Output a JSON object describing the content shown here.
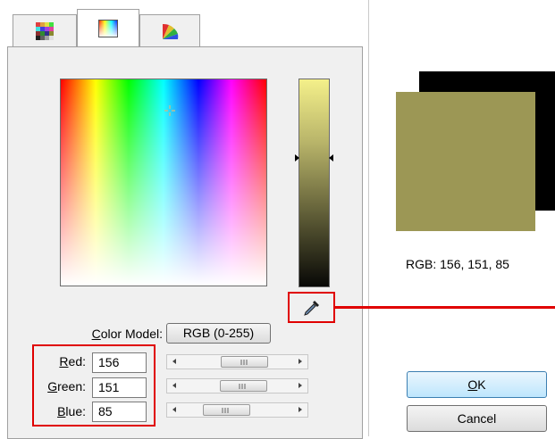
{
  "tabs": [
    {
      "icon": "swatch-grid-icon"
    },
    {
      "icon": "color-gradient-icon",
      "selected": true
    },
    {
      "icon": "color-wheel-icon"
    }
  ],
  "picker": {
    "eyedropper_icon": "eyedropper-icon"
  },
  "color_model": {
    "label_prefix": "",
    "label_mnemonic": "C",
    "label_rest": "olor Model:",
    "value": "RGB (0-255)"
  },
  "channels": [
    {
      "mnemonic": "R",
      "label_rest": "ed:",
      "value": "156",
      "fraction": 0.612
    },
    {
      "mnemonic": "G",
      "label_rest": "reen:",
      "value": "151",
      "fraction": 0.592
    },
    {
      "mnemonic": "B",
      "label_rest": "lue:",
      "value": "85",
      "fraction": 0.333
    }
  ],
  "preview": {
    "old_color": "#000000",
    "new_color": "#9c9755",
    "readout": "RGB: 156, 151, 85"
  },
  "buttons": {
    "ok_mnemonic": "O",
    "ok_rest": "K",
    "cancel": "Cancel"
  },
  "colors": {
    "highlight": "#e00000"
  }
}
